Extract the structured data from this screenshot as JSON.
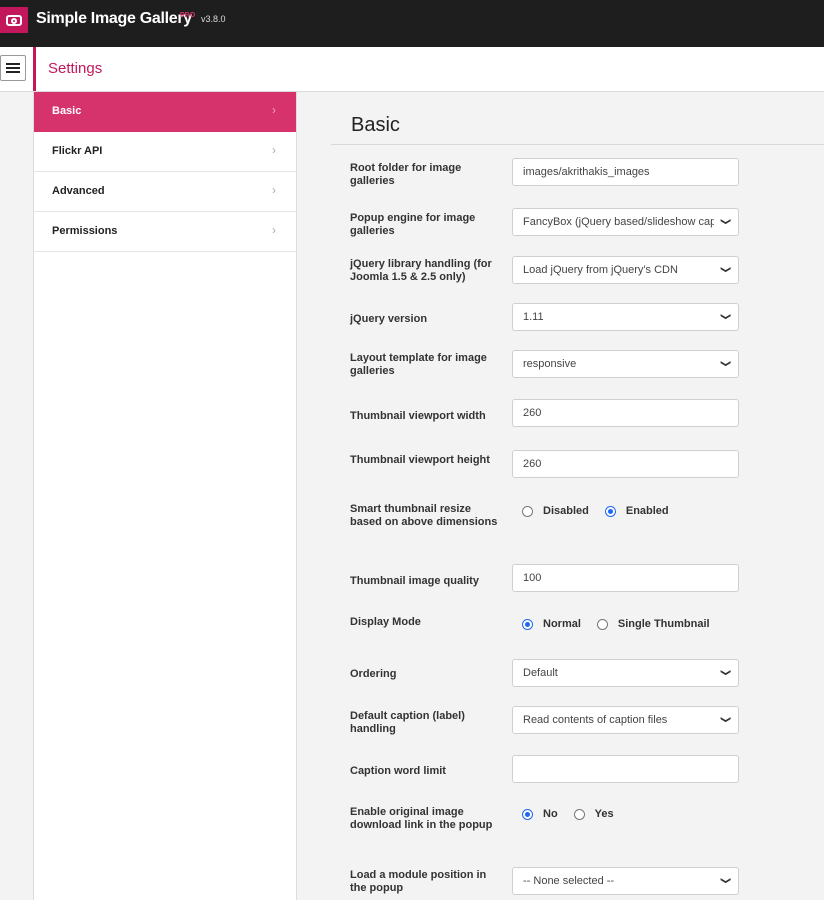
{
  "app": {
    "title": "Simple Image Gallery",
    "badge": "PRO",
    "version": "v3.8.0",
    "logo_icon": "camera-icon",
    "accent_color": "#c2185b",
    "active_color": "#d6336c"
  },
  "header": {
    "title": "Settings",
    "menu_icon": "hamburger-menu-icon"
  },
  "sidebar": {
    "items": [
      {
        "label": "Basic",
        "active": true
      },
      {
        "label": "Flickr API",
        "active": false
      },
      {
        "label": "Advanced",
        "active": false
      },
      {
        "label": "Permissions",
        "active": false
      }
    ],
    "chevron": "›"
  },
  "main": {
    "section_title": "Basic",
    "fields": {
      "root_folder": {
        "label": "Root folder for image galleries",
        "value": "images/akrithakis_images"
      },
      "popup_engine": {
        "label": "Popup engine for image galleries",
        "value": "FancyBox (jQuery based/slideshow capable)"
      },
      "jquery_handling": {
        "label": "jQuery library handling (for Joomla 1.5 & 2.5 only)",
        "value": "Load jQuery from jQuery's CDN"
      },
      "jquery_version": {
        "label": "jQuery version",
        "value": "1.11"
      },
      "layout_template": {
        "label": "Layout template for image galleries",
        "value": "responsive"
      },
      "thumb_width": {
        "label": "Thumbnail viewport width",
        "value": "260"
      },
      "thumb_height": {
        "label": "Thumbnail viewport height",
        "value": "260"
      },
      "smart_resize": {
        "label": "Smart thumbnail resize based on above dimensions",
        "options": [
          "Disabled",
          "Enabled"
        ],
        "selected": "Enabled"
      },
      "thumb_quality": {
        "label": "Thumbnail image quality",
        "value": "100"
      },
      "display_mode": {
        "label": "Display Mode",
        "options": [
          "Normal",
          "Single Thumbnail"
        ],
        "selected": "Normal"
      },
      "ordering": {
        "label": "Ordering",
        "value": "Default"
      },
      "caption_handling": {
        "label": "Default caption (label) handling",
        "value": "Read contents of caption files"
      },
      "caption_word_limit": {
        "label": "Caption word limit",
        "value": ""
      },
      "download_link": {
        "label": "Enable original image download link in the popup",
        "options": [
          "No",
          "Yes"
        ],
        "selected": "No"
      },
      "module_position": {
        "label": "Load a module position in the popup",
        "value": "-- None selected --"
      }
    }
  }
}
